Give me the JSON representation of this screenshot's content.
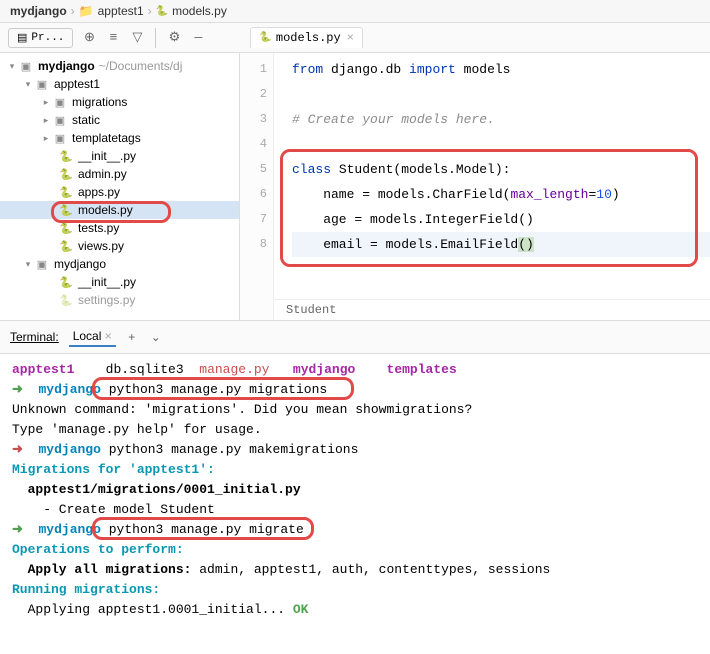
{
  "breadcrumb": {
    "root": "mydjango",
    "mid": "apptest1",
    "file": "models.py"
  },
  "toolbar": {
    "selector": "Pr..."
  },
  "tab": {
    "label": "models.py"
  },
  "project": {
    "root": {
      "name": "mydjango",
      "path": "~/Documents/dj"
    },
    "apptest1": "apptest1",
    "migrations": "migrations",
    "static": "static",
    "templatetags": "templatetags",
    "init": "__init__.py",
    "admin": "admin.py",
    "apps": "apps.py",
    "models": "models.py",
    "tests": "tests.py",
    "views": "views.py",
    "mydjango": "mydjango",
    "init2": "__init__.py",
    "settings": "settings.py"
  },
  "code": {
    "line1_kw1": "from",
    "line1_pkg": " django.db ",
    "line1_kw2": "import",
    "line1_mod": " models",
    "line3_cmt": "# Create your models here.",
    "line5_kw": "class",
    "line5_cls": " Student(models.Model):",
    "line6_var": "    name = models.CharField(",
    "line6_kwp": "max_length",
    "line6_eq": "=",
    "line6_num": "10",
    "line6_end": ")",
    "line7": "    age = models.IntegerField()",
    "line8_pre": "    email = models.EmailField",
    "line8_par": "()"
  },
  "editor_bread": "Student",
  "terminal": {
    "header": "Terminal:",
    "tab": "Local",
    "close": "×",
    "plus": "+",
    "chev": "⌄",
    "ls1": "apptest1",
    "ls2": "db.sqlite3",
    "ls3": "manage.py",
    "ls4": "mydjango",
    "ls5": "templates",
    "prompt": "mydjango",
    "cmd1": "python3 manage.py migrations",
    "err1": "Unknown command: 'migrations'. Did you mean showmigrations?",
    "err2": "Type 'manage.py help' for usage.",
    "cmd2": "python3 manage.py makemigrations",
    "mig1": "Migrations for 'apptest1':",
    "mig2": "  apptest1/migrations/0001_initial.py",
    "mig3": "    - Create model Student",
    "cmd3": "python3 manage.py migrate",
    "op1": "Operations to perform:",
    "op2_a": "  Apply all migrations: ",
    "op2_b": "admin, apptest1, auth, contenttypes, sessions",
    "run1": "Running migrations:",
    "run2_a": "  Applying apptest1.0001_initial...",
    "run2_b": " OK"
  }
}
